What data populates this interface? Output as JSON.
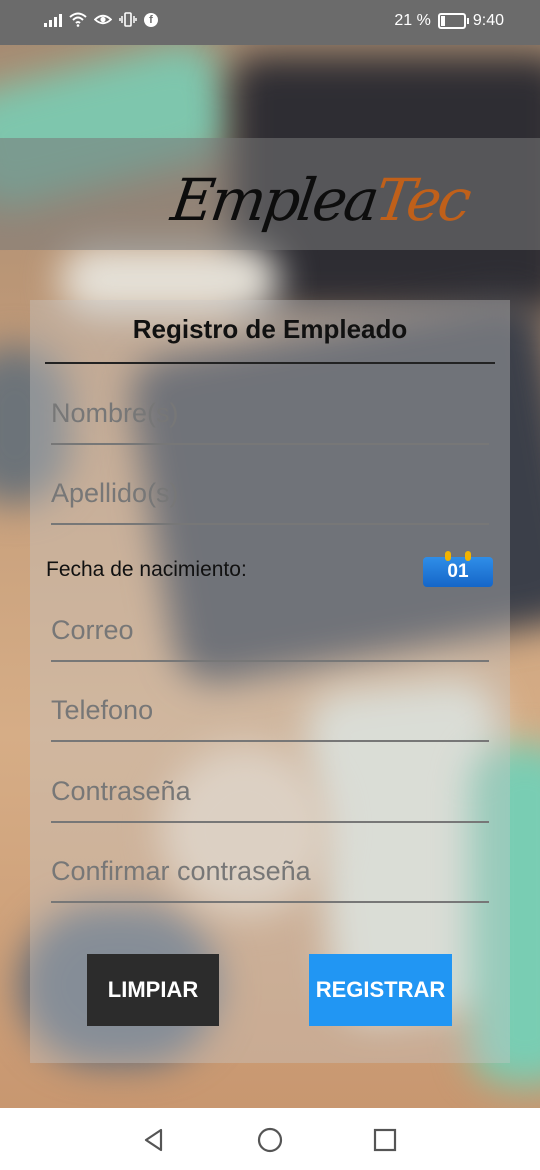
{
  "status_bar": {
    "battery_text": "21 %",
    "battery_level": 0.21,
    "time": "9:40",
    "icons": [
      "signal-icon",
      "wifi-icon",
      "eye-icon",
      "vibrate-icon",
      "facebook-icon"
    ]
  },
  "logo": {
    "part1": "Emplea",
    "part2": "Tec",
    "color1": "#0d0d0d",
    "color2": "#c0601a"
  },
  "form": {
    "title": "Registro de Empleado",
    "fields": {
      "nombre": {
        "placeholder": "Nombre(s)",
        "value": ""
      },
      "apellido": {
        "placeholder": "Apellido(s)",
        "value": ""
      },
      "correo": {
        "placeholder": "Correo",
        "value": ""
      },
      "telefono": {
        "placeholder": "Telefono",
        "value": ""
      },
      "contrasena": {
        "placeholder": "Contraseña",
        "value": ""
      },
      "confirmar": {
        "placeholder": "Confirmar contraseña",
        "value": ""
      }
    },
    "dob_label": "Fecha de nacimiento:",
    "calendar_day": "01",
    "buttons": {
      "clear": "LIMPIAR",
      "register": "REGISTRAR"
    }
  },
  "colors": {
    "register_button": "#2196f3",
    "clear_button": "#2c2c2c",
    "calendar_icon": "#2f8ee8"
  },
  "nav_bar": {
    "icons": [
      "back-icon",
      "home-icon",
      "recents-icon"
    ]
  }
}
